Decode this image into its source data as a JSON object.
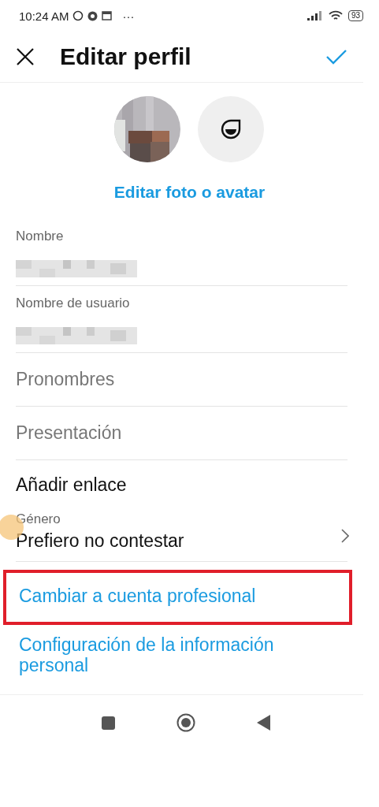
{
  "status_bar": {
    "time": "10:24 AM",
    "more": "···",
    "battery": "93"
  },
  "header": {
    "title": "Editar perfil"
  },
  "photo": {
    "link": "Editar foto o avatar"
  },
  "fields": [
    {
      "kind": "value",
      "label": "Nombre"
    },
    {
      "kind": "value",
      "label": "Nombre de usuario"
    },
    {
      "kind": "placeholder",
      "placeholder": "Pronombres"
    },
    {
      "kind": "placeholder",
      "placeholder": "Presentación"
    },
    {
      "kind": "link",
      "text": "Añadir enlace"
    },
    {
      "kind": "select",
      "label": "Género",
      "value": "Prefiero no contestar"
    }
  ],
  "actions": [
    {
      "text": "Cambiar a cuenta profesional",
      "highlighted": true
    },
    {
      "text": "Configuración de la información personal",
      "highlighted": false
    }
  ]
}
